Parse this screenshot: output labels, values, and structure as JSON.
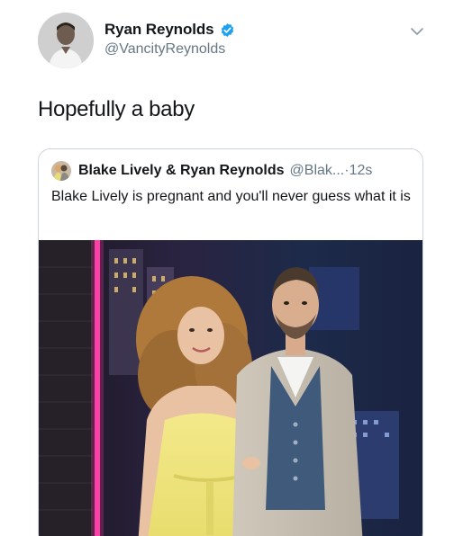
{
  "tweet": {
    "author": {
      "display_name": "Ryan Reynolds",
      "handle": "@VancityReynolds",
      "verified": true,
      "avatar_icon": "profile-photo"
    },
    "text": "Hopefully a baby",
    "menu_icon": "chevron-down-icon"
  },
  "quoted_tweet": {
    "author": {
      "display_name": "Blake Lively & Ryan Reynolds",
      "handle": "@Blak...",
      "avatar_icon": "profile-photo"
    },
    "separator": " · ",
    "time": "12s",
    "text": "Blake Lively is pregnant and you'll never guess what it is",
    "photo_icon": "red-carpet-photo"
  },
  "colors": {
    "text_primary": "#14171a",
    "text_secondary": "#657786",
    "verified_blue": "#1da1f2",
    "card_border": "#ccd6dd"
  }
}
